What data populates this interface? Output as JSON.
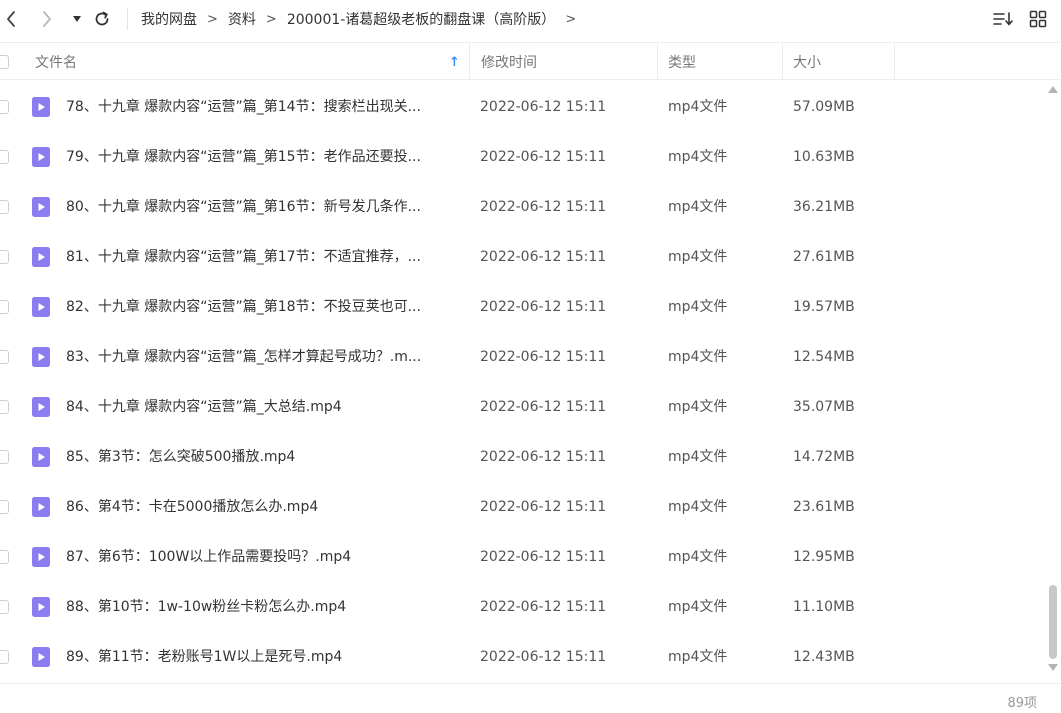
{
  "nav": {
    "back_icon": "chevron-left-icon",
    "forward_icon": "chevron-right-icon",
    "dropdown_icon": "caret-down-icon",
    "refresh_icon": "refresh-icon"
  },
  "breadcrumb": [
    "我的网盘",
    "资料",
    "200001-诸葛超级老板的翻盘课（高阶版）"
  ],
  "breadcrumb_separator": ">",
  "toolbar": {
    "sort_icon": "sort-list-icon",
    "view_icon": "grid-view-icon"
  },
  "table": {
    "columns": {
      "name": "文件名",
      "modified": "修改时间",
      "type": "类型",
      "size": "大小"
    },
    "sort_indicator": "↑",
    "rows": [
      {
        "name": "78、十九章 爆款内容“运营”篇_第14节：搜索栏出现关...",
        "modified": "2022-06-12 15:11",
        "type": "mp4文件",
        "size": "57.09MB"
      },
      {
        "name": "79、十九章 爆款内容“运营”篇_第15节：老作品还要投...",
        "modified": "2022-06-12 15:11",
        "type": "mp4文件",
        "size": "10.63MB"
      },
      {
        "name": "80、十九章 爆款内容“运营”篇_第16节：新号发几条作...",
        "modified": "2022-06-12 15:11",
        "type": "mp4文件",
        "size": "36.21MB"
      },
      {
        "name": "81、十九章 爆款内容“运营”篇_第17节：不适宜推荐，...",
        "modified": "2022-06-12 15:11",
        "type": "mp4文件",
        "size": "27.61MB"
      },
      {
        "name": "82、十九章 爆款内容“运营”篇_第18节：不投豆荚也可...",
        "modified": "2022-06-12 15:11",
        "type": "mp4文件",
        "size": "19.57MB"
      },
      {
        "name": "83、十九章 爆款内容“运营”篇_怎样才算起号成功？.m...",
        "modified": "2022-06-12 15:11",
        "type": "mp4文件",
        "size": "12.54MB"
      },
      {
        "name": "84、十九章 爆款内容“运营”篇_大总结.mp4",
        "modified": "2022-06-12 15:11",
        "type": "mp4文件",
        "size": "35.07MB"
      },
      {
        "name": "85、第3节：怎么突破500播放.mp4",
        "modified": "2022-06-12 15:11",
        "type": "mp4文件",
        "size": "14.72MB"
      },
      {
        "name": "86、第4节：卡在5000播放怎么办.mp4",
        "modified": "2022-06-12 15:11",
        "type": "mp4文件",
        "size": "23.61MB"
      },
      {
        "name": "87、第6节：100W以上作品需要投吗？.mp4",
        "modified": "2022-06-12 15:11",
        "type": "mp4文件",
        "size": "12.95MB"
      },
      {
        "name": "88、第10节：1w-10w粉丝卡粉怎么办.mp4",
        "modified": "2022-06-12 15:11",
        "type": "mp4文件",
        "size": "11.10MB"
      },
      {
        "name": "89、第11节：老粉账号1W以上是死号.mp4",
        "modified": "2022-06-12 15:11",
        "type": "mp4文件",
        "size": "12.43MB"
      }
    ]
  },
  "footer": {
    "item_count": "89项"
  },
  "colors": {
    "file_icon": "#8b7cf0",
    "sort_arrow": "#3b8cf0",
    "text": "#333333",
    "muted": "#999999"
  }
}
